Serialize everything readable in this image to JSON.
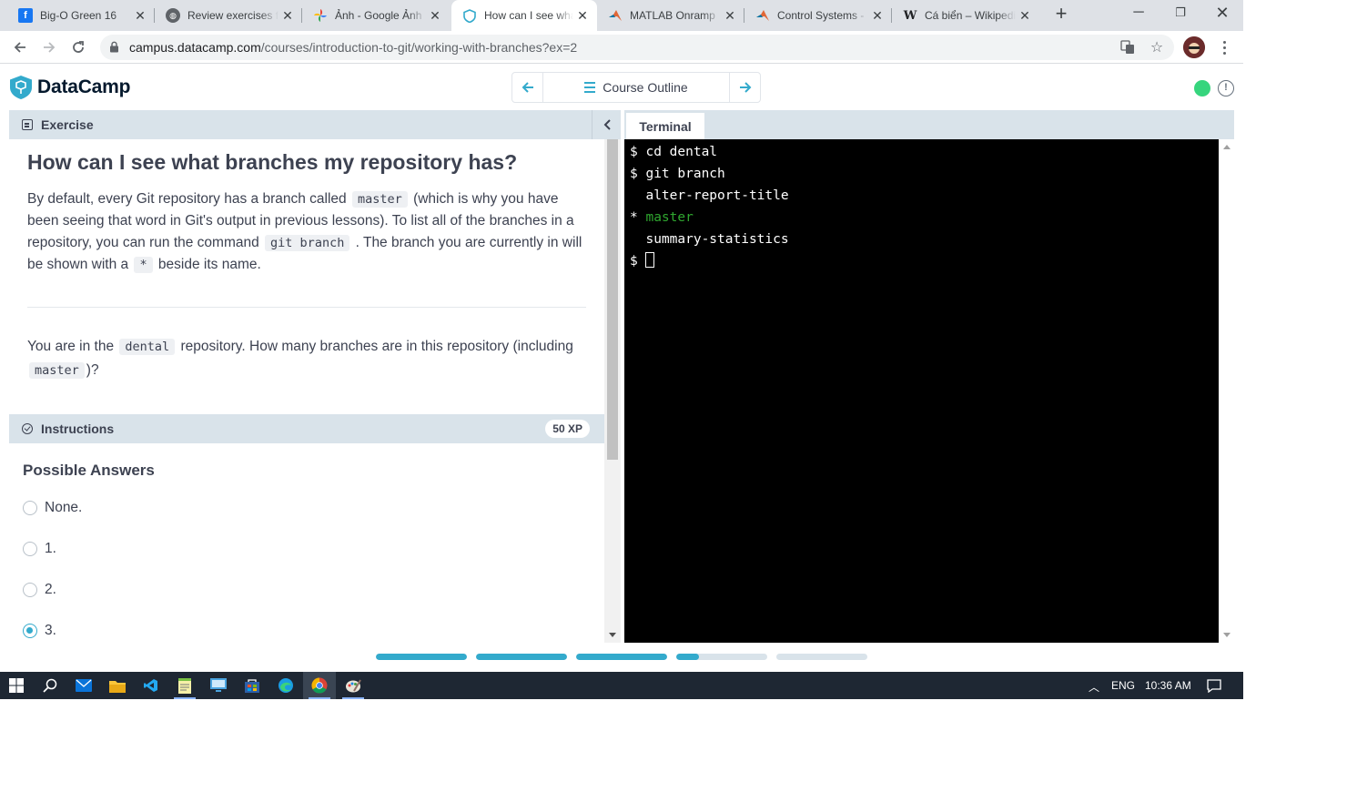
{
  "browser": {
    "tabs": [
      {
        "title": "Big-O Green 16",
        "icon": "facebook-icon",
        "active": false
      },
      {
        "title": "Review exercises for",
        "icon": "globe-icon",
        "active": false
      },
      {
        "title": "Ảnh - Google Ảnh",
        "icon": "google-photos-icon",
        "active": false
      },
      {
        "title": "How can I see what",
        "icon": "datacamp-shield-icon",
        "active": true
      },
      {
        "title": "MATLAB Onramp",
        "icon": "matlab-icon",
        "active": false
      },
      {
        "title": "Control Systems -",
        "icon": "matlab-icon",
        "active": false
      },
      {
        "title": "Cá biển – Wikipedia",
        "icon": "wikipedia-icon",
        "active": false
      }
    ],
    "url_host": "campus.datacamp.com",
    "url_path": "/courses/introduction-to-git/working-with-branches?ex=2"
  },
  "header": {
    "brand": "DataCamp",
    "course_outline_label": "Course Outline",
    "status_color": "#36d57d"
  },
  "exercise": {
    "section_label": "Exercise",
    "title": "How can I see what branches my repository has?",
    "body": {
      "p1": "By default, every Git repository has a branch called",
      "code1": "master",
      "p2": "(which is why you have been seeing that word in Git's output in previous lessons). To list all of the branches in a repository, you can run the command",
      "code2": "git branch",
      "p3": ". The branch you are currently in will be shown with a",
      "code3": "*",
      "p4": "beside its name."
    },
    "question": {
      "q1": "You are in the",
      "code1": "dental",
      "q2": "repository. How many branches are in this repository (including",
      "code2": "master",
      "q3": ")?"
    }
  },
  "instructions": {
    "label": "Instructions",
    "xp": "50 XP",
    "answers_title": "Possible Answers",
    "answers": [
      {
        "label": "None.",
        "selected": false
      },
      {
        "label": "1.",
        "selected": false
      },
      {
        "label": "2.",
        "selected": false
      },
      {
        "label": "3.",
        "selected": true
      }
    ]
  },
  "terminal": {
    "tab_label": "Terminal",
    "lines": [
      {
        "prefix": "$ ",
        "text": "cd dental"
      },
      {
        "prefix": "$ ",
        "text": "git branch"
      },
      {
        "prefix": "  ",
        "text": "alter-report-title"
      },
      {
        "prefix": "* ",
        "text": "master",
        "highlight": "#2fa72f"
      },
      {
        "prefix": "  ",
        "text": "summary-statistics"
      },
      {
        "prefix": "$ ",
        "text": ""
      }
    ]
  },
  "progress": {
    "segments": [
      1,
      1,
      1,
      0.25,
      0
    ],
    "accent": "#33aacc"
  },
  "taskbar": {
    "apps": [
      "windows-start-icon",
      "search-icon",
      "mail-icon",
      "file-explorer-icon",
      "vscode-icon",
      "notepad-icon",
      "remote-desktop-icon",
      "store-icon",
      "edge-icon",
      "chrome-icon",
      "paint-icon"
    ],
    "language": "ENG",
    "time": "10:36 AM"
  }
}
